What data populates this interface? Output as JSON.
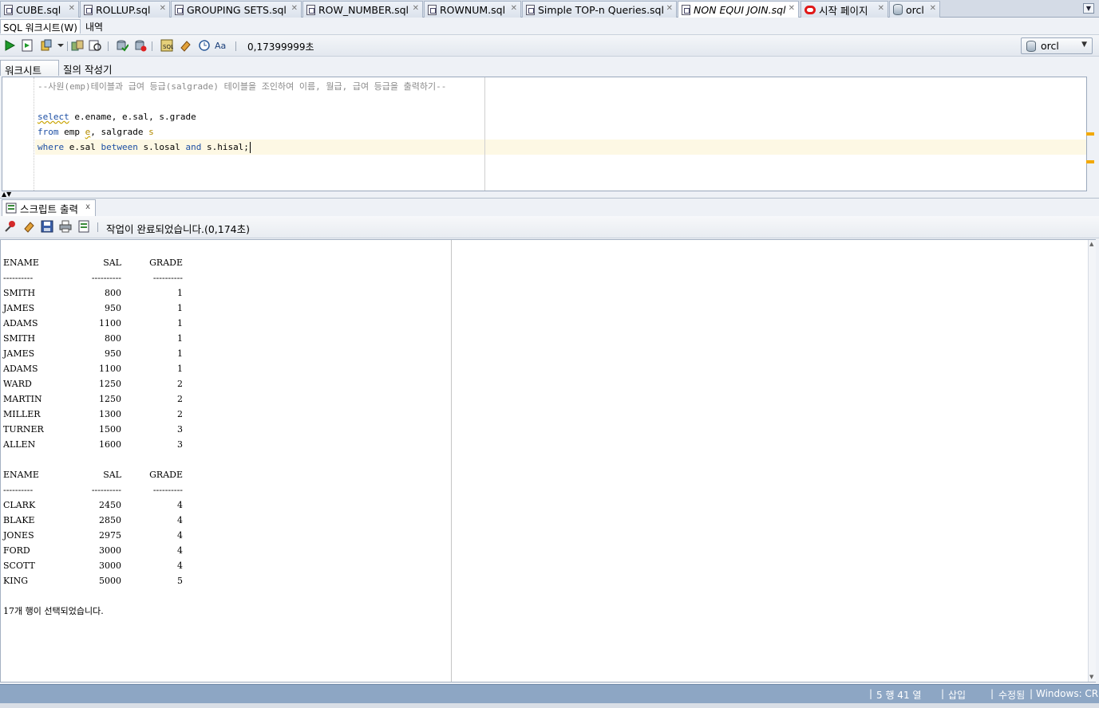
{
  "tabs": [
    {
      "label": "CUBE.sql",
      "icon": "sql-file-icon",
      "active": false
    },
    {
      "label": "ROLLUP.sql",
      "icon": "sql-file-icon",
      "active": false
    },
    {
      "label": "GROUPING SETS.sql",
      "icon": "sql-file-icon",
      "active": false
    },
    {
      "label": "ROW_NUMBER.sql",
      "icon": "sql-file-icon",
      "active": false
    },
    {
      "label": "ROWNUM.sql",
      "icon": "sql-file-icon",
      "active": false
    },
    {
      "label": "Simple TOP-n Queries.sql",
      "icon": "sql-file-icon",
      "active": false
    },
    {
      "label": "NON EQUI JOIN.sql",
      "icon": "sql-file-icon",
      "active": true
    },
    {
      "label": "시작 페이지",
      "icon": "oracle-logo-icon",
      "active": false
    },
    {
      "label": "orcl",
      "icon": "database-connection-icon",
      "active": false
    }
  ],
  "subtabs": {
    "worksheet": "SQL 워크시트(W)",
    "history": "내역"
  },
  "toolbar": {
    "elapsed": "0,17399999초",
    "connection": "orcl"
  },
  "editor_tabs": {
    "worksheet": "워크시트",
    "query_builder": "질의 작성기"
  },
  "editor": {
    "lines": [
      "--사원(emp)테이블과 급여 등급(salgrade) 테이블을 조인하여 이름, 월급, 급여 등급을 출력하기--",
      "",
      "select e.ename, e.sal, s.grade",
      "from emp e, salgrade s",
      "where e.sal between s.losal and s.hisal;"
    ]
  },
  "output_panel": {
    "tab_label": "스크립트 출력",
    "close": "x",
    "status": "작업이 완료되었습니다.(0,174초)"
  },
  "results": {
    "headers": [
      "ENAME",
      "SAL",
      "GRADE"
    ],
    "separator": [
      "----------",
      "----------",
      "----------"
    ],
    "block1": [
      [
        "SMITH",
        "800",
        "1"
      ],
      [
        "JAMES",
        "950",
        "1"
      ],
      [
        "ADAMS",
        "1100",
        "1"
      ],
      [
        "SMITH",
        "800",
        "1"
      ],
      [
        "JAMES",
        "950",
        "1"
      ],
      [
        "ADAMS",
        "1100",
        "1"
      ],
      [
        "WARD",
        "1250",
        "2"
      ],
      [
        "MARTIN",
        "1250",
        "2"
      ],
      [
        "MILLER",
        "1300",
        "2"
      ],
      [
        "TURNER",
        "1500",
        "3"
      ],
      [
        "ALLEN",
        "1600",
        "3"
      ]
    ],
    "block2": [
      [
        "CLARK",
        "2450",
        "4"
      ],
      [
        "BLAKE",
        "2850",
        "4"
      ],
      [
        "JONES",
        "2975",
        "4"
      ],
      [
        "FORD",
        "3000",
        "4"
      ],
      [
        "SCOTT",
        "3000",
        "4"
      ],
      [
        "KING",
        "5000",
        "5"
      ]
    ],
    "summary": "17개 행이 선택되었습니다."
  },
  "statusbar": {
    "position": "5 행 41 열",
    "mode": "삽입",
    "modified": "수정됨",
    "encoding": "Windows: CR"
  }
}
